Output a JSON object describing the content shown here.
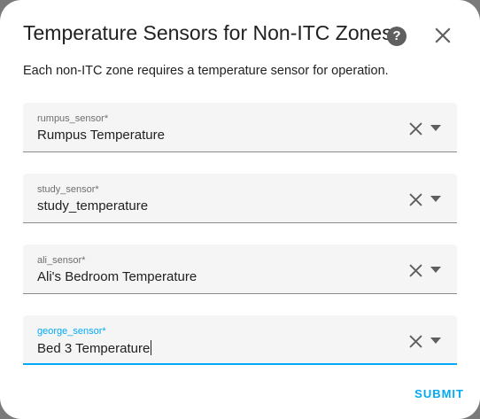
{
  "dialog": {
    "title": "Temperature Sensors for Non-ITC Zones",
    "help_glyph": "?",
    "description": "Each non-ITC zone requires a temperature sensor for operation."
  },
  "fields": [
    {
      "label": "rumpus_sensor*",
      "value": "Rumpus Temperature"
    },
    {
      "label": "study_sensor*",
      "value": "study_temperature"
    },
    {
      "label": "ali_sensor*",
      "value": "Ali's Bedroom Temperature"
    },
    {
      "label": "george_sensor*",
      "value": "Bed 3 Temperature"
    }
  ],
  "actions": {
    "submit_label": "SUBMIT"
  },
  "colors": {
    "accent": "#03a9f4",
    "field_background": "#f5f5f5",
    "text": "#212121"
  },
  "icons": {
    "help": "help-circle-icon",
    "close": "close-icon",
    "clear": "clear-icon",
    "dropdown": "chevron-down-icon"
  }
}
